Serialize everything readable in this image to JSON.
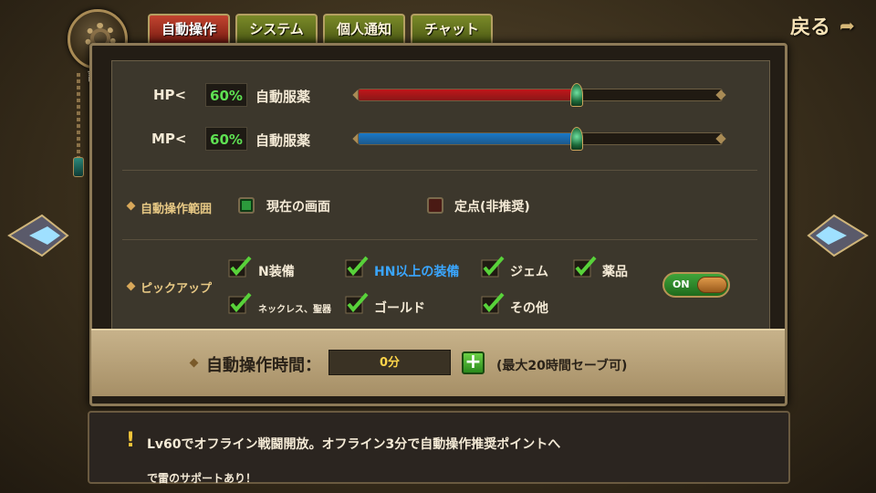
{
  "emblem": {
    "label": "設定",
    "icon": "gear-icon"
  },
  "tabs": [
    {
      "label": "自動操作",
      "active": true
    },
    {
      "label": "システム",
      "active": false
    },
    {
      "label": "個人通知",
      "active": false
    },
    {
      "label": "チャット",
      "active": false
    }
  ],
  "back": {
    "label": "戻る"
  },
  "hp": {
    "label": "HP<",
    "percent": "60%",
    "action": "自動服薬",
    "fill_fraction": 0.6,
    "color": "#c0161a"
  },
  "mp": {
    "label": "MP<",
    "percent": "60%",
    "action": "自動服薬",
    "fill_fraction": 0.6,
    "color": "#1a78c8"
  },
  "range": {
    "label": "自動操作範囲",
    "options": [
      {
        "label": "現在の画面",
        "selected": true
      },
      {
        "label": "定点(非推奨)",
        "selected": false
      }
    ]
  },
  "pickup": {
    "label": "ピックアップ",
    "items": [
      {
        "label": "N装備",
        "checked": true
      },
      {
        "label": "HN以上の装備",
        "checked": true
      },
      {
        "label": "ジェム",
        "checked": true
      },
      {
        "label": "薬品",
        "checked": true
      },
      {
        "label": "ネックレス、聖器",
        "checked": true
      },
      {
        "label": "ゴールド",
        "checked": true
      },
      {
        "label": "その他",
        "checked": true
      }
    ],
    "toggle": "ON"
  },
  "auto_time": {
    "label": "自動操作時間：",
    "value": "0分",
    "plus": "+",
    "note": "(最大20時間セーブ可)"
  },
  "tip": {
    "line1": "Lv60でオフライン戦闘開放。オフライン3分で自動操作推奨ポイントへ",
    "line2": "で雷のサポートあり！"
  }
}
